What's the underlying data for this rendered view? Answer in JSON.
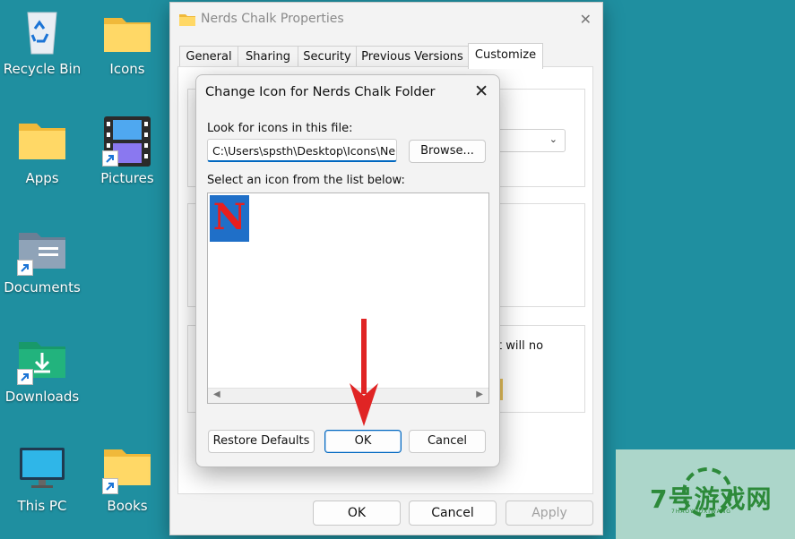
{
  "desktop": {
    "icons": [
      {
        "label": "Recycle Bin"
      },
      {
        "label": "Icons"
      },
      {
        "label": "Apps"
      },
      {
        "label": "Pictures"
      },
      {
        "label": "Documents"
      },
      {
        "label": "Downloads"
      },
      {
        "label": "This PC"
      },
      {
        "label": "Books"
      }
    ]
  },
  "properties_window": {
    "title": "Nerds Chalk Properties",
    "tabs": [
      {
        "label": "General"
      },
      {
        "label": "Sharing"
      },
      {
        "label": "Security"
      },
      {
        "label": "Previous Versions"
      },
      {
        "label": "Customize"
      }
    ],
    "active_tab": "Customize",
    "partial_text": "t will no",
    "buttons": {
      "ok": "OK",
      "cancel": "Cancel",
      "apply": "Apply"
    }
  },
  "change_icon_dialog": {
    "title": "Change Icon for Nerds Chalk Folder",
    "look_for_label": "Look for icons in this file:",
    "file_path": "C:\\Users\\spsth\\Desktop\\Icons\\Nerds",
    "browse_button": "Browse...",
    "select_label": "Select an icon from the list below:",
    "icons": [
      {
        "glyph": "N",
        "bg_color": "#1f6fc8",
        "fg_color": "#e81e1e"
      }
    ],
    "restore_defaults_button": "Restore Defaults",
    "ok_button": "OK",
    "cancel_button": "Cancel"
  },
  "watermark": {
    "text": "7号游戏网",
    "sub": "7HAOYOUXIWANG"
  },
  "colors": {
    "desktop_bg": "#1f8fa0",
    "accent": "#0067c0",
    "arrow": "#e02424"
  }
}
